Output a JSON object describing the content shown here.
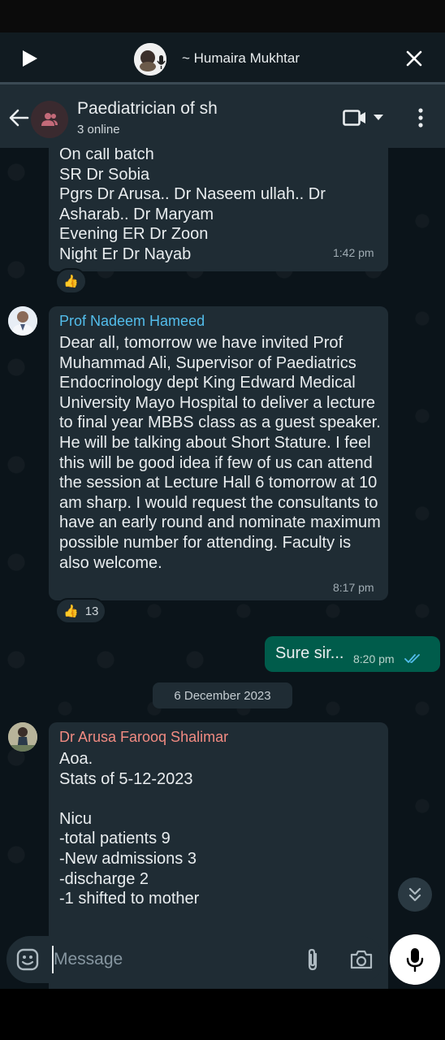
{
  "voice_chat": {
    "title": "~ Humaira Mukhtar"
  },
  "header": {
    "title": "Paediatrician of sh",
    "subtitle": "3 online"
  },
  "messages": [
    {
      "text": "On call batch\nSR Dr Sobia\nPgrs Dr Arusa.. Dr Naseem ullah.. Dr Asharab.. Dr Maryam\nEvening ER Dr Zoon\nNight Er Dr Nayab",
      "time": "1:42 pm",
      "reaction": {
        "emoji": "👍",
        "count": ""
      }
    },
    {
      "sender": "Prof Nadeem Hameed",
      "sender_color": "#53bdeb",
      "text": "Dear all, tomorrow we have invited Prof Muhammad Ali, Supervisor of Paediatrics Endocrinology dept King Edward Medical University Mayo Hospital to deliver a lecture to final year MBBS class as a guest speaker. He will be talking about Short Stature. I feel this will be good idea if few of us can attend the session at Lecture Hall 6 tomorrow at 10 am sharp. I would request the consultants to have an early round and nominate maximum possible number for attending. Faculty is also welcome.",
      "time": "8:17 pm",
      "reaction": {
        "emoji": "👍",
        "count": "13"
      }
    },
    {
      "outgoing": true,
      "text": "Sure sir...",
      "time": "8:20 pm",
      "status": "read"
    },
    {
      "date_separator": "6 December 2023"
    },
    {
      "sender": "Dr Arusa Farooq Shalimar",
      "sender_color": "#f28b82",
      "text": "Aoa.\nStats of 5-12-2023\n\nNicu\n-total patients 9\n-New admissions 3\n-discharge 2\n-1 shifted to mother"
    }
  ],
  "composer": {
    "placeholder": "Message"
  },
  "colors": {
    "header_bg": "#1f2c34",
    "chat_bg": "#0b141a",
    "incoming_bubble": "#1f2c34",
    "outgoing_bubble": "#005c4b",
    "read_ticks": "#53bdeb"
  },
  "icons": {
    "voice_play": "play-icon",
    "voice_close": "close-icon",
    "back": "back-arrow-icon",
    "group": "group-icon",
    "video": "video-call-icon",
    "dropdown": "chevron-down-icon",
    "menu": "more-vertical-icon",
    "emoji": "emoji-icon",
    "attach": "paperclip-icon",
    "camera": "camera-icon",
    "mic": "mic-icon",
    "scroll_down": "double-chevron-down-icon"
  }
}
